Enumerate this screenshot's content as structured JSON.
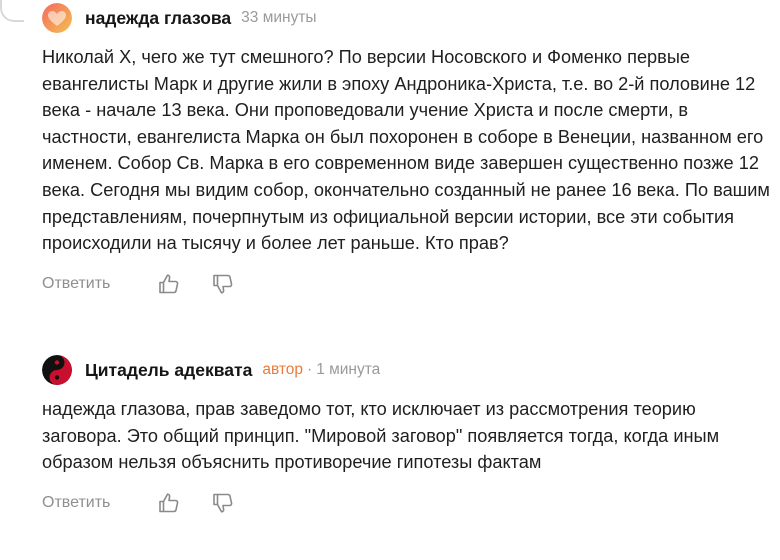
{
  "comments": [
    {
      "author": "надежда глазова",
      "time": "33 минуты",
      "text": "Николай Х, чего же тут смешного? По версии Носовского и Фоменко первые евангелисты Марк и другие жили в эпоху Андроника-Христа, т.е. во 2-й половине 12 века - начале 13 века. Они проповедовали учение Христа и после смерти, в частности, евангелиста Марка он был похоронен в соборе в Венеции, названном его именем. Собор Св. Марка в его современном виде завершен существенно позже 12 века. Сегодня мы видим собор, окончательно созданный не ранее 16 века. По вашим представлениям, почерпнутым из официальной версии истории, все эти события происходили на тысячу и более лет раньше. Кто прав?",
      "reply_label": "Ответить",
      "avatar_icon": "heart-gradient-avatar",
      "avatar_colors": [
        "#f26a5f",
        "#f5c052"
      ]
    },
    {
      "author": "Цитадель адеквата",
      "badge": "автор",
      "separator": "·",
      "time": "1 минута",
      "text": "надежда глазова, прав заведомо тот, кто исключает из рассмотрения теорию заговора. Это общий принцип. \"Мировой заговор\" появляется тогда, когда иным образом нельзя объяснить противоречие гипотезы фактам",
      "reply_label": "Ответить",
      "avatar_icon": "yin-yang-avatar",
      "avatar_colors": [
        "#c8102e",
        "#111111"
      ]
    }
  ],
  "icons": {
    "like": "thumbs-up-icon",
    "dislike": "thumbs-down-icon"
  },
  "colors": {
    "badge": "#ec7a3a",
    "muted": "#9a9a9a"
  }
}
